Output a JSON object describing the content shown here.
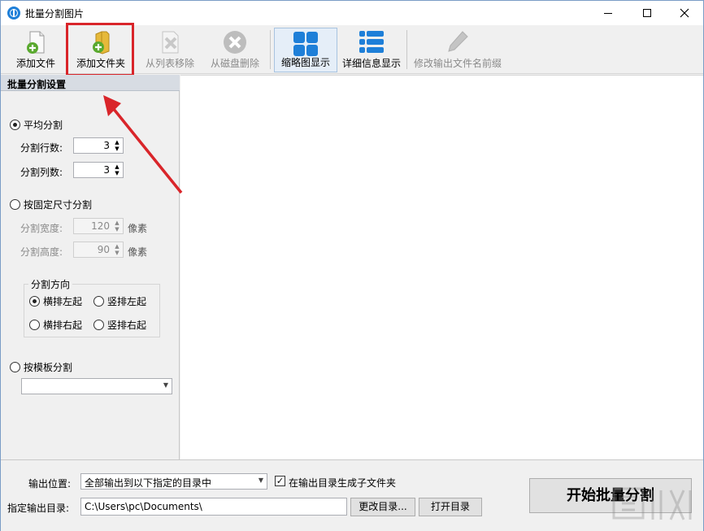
{
  "window": {
    "title": "批量分割图片"
  },
  "toolbar": {
    "add_file": "添加文件",
    "add_folder": "添加文件夹",
    "remove_from_list": "从列表移除",
    "delete_from_disk": "从磁盘删除",
    "thumbnail_view": "缩略图显示",
    "detail_view": "详细信息显示",
    "rename_prefix": "修改输出文件名前缀"
  },
  "settings": {
    "header": "批量分割设置",
    "mode_average": "平均分割",
    "rows_label": "分割行数:",
    "rows_value": "3",
    "cols_label": "分割列数:",
    "cols_value": "3",
    "mode_fixed": "按固定尺寸分割",
    "width_label": "分割宽度:",
    "width_value": "120",
    "height_label": "分割高度:",
    "height_value": "90",
    "unit": "像素",
    "direction_title": "分割方向",
    "dir_h_left": "横排左起",
    "dir_v_left": "竖排左起",
    "dir_h_right": "横排右起",
    "dir_v_right": "竖排右起",
    "mode_template": "按模板分割",
    "template_value": ""
  },
  "bottom": {
    "output_location_label": "输出位置:",
    "output_location_value": "全部输出到以下指定的目录中",
    "subfolder_label": "在输出目录生成子文件夹",
    "output_dir_label": "指定输出目录:",
    "output_dir_value": "C:\\Users\\pc\\Documents\\",
    "change_dir": "更改目录...",
    "open_dir": "打开目录",
    "start": "开始批量分割"
  },
  "colors": {
    "accent": "#1e7fd8",
    "highlight": "#d9252a"
  }
}
